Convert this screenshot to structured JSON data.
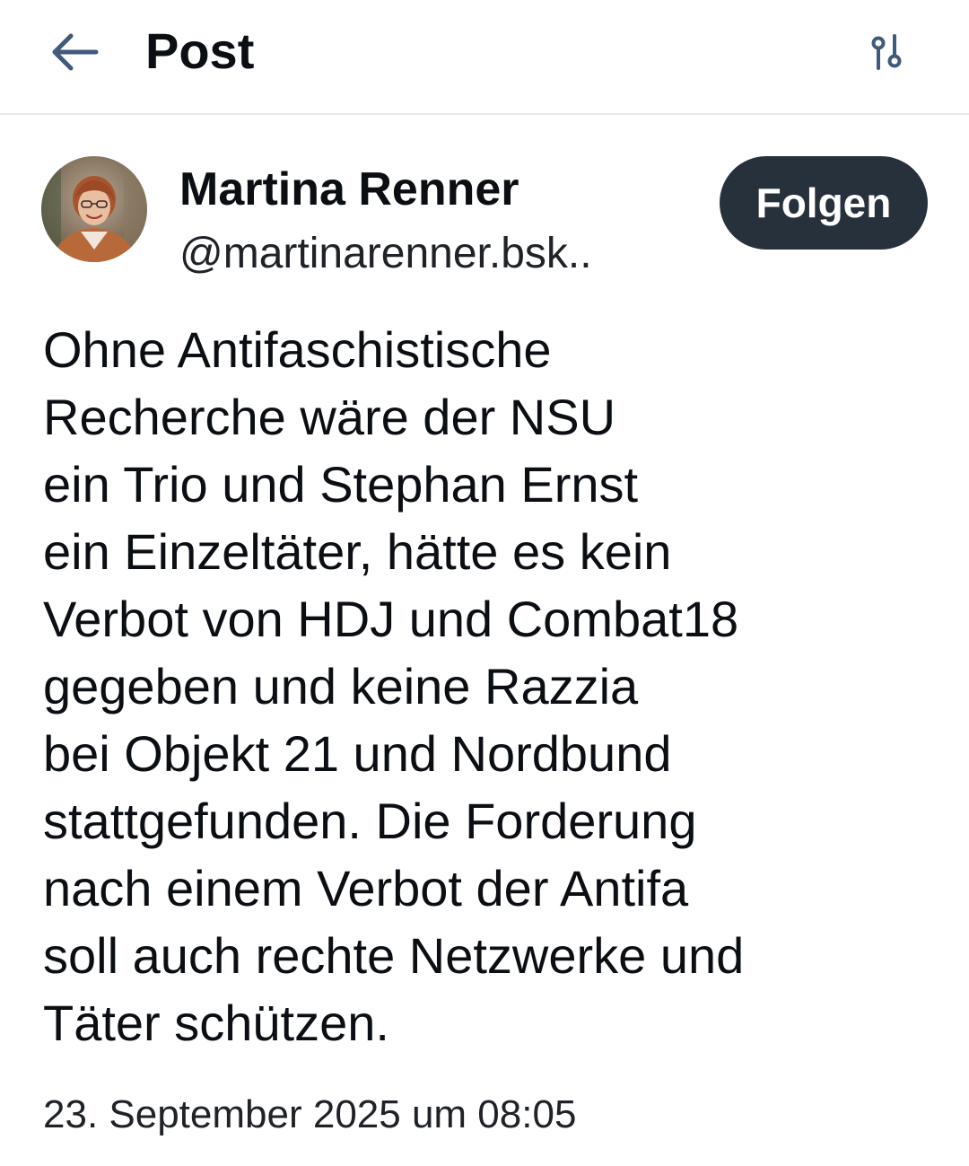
{
  "header": {
    "title": "Post",
    "back_icon": "arrow-left-icon",
    "settings_icon": "sliders-icon",
    "icon_color": "#3f5a7c"
  },
  "author": {
    "name": "Martina Renner",
    "handle": "@martinarenner.bsk..",
    "follow_label": "Folgen",
    "follow_bg": "#27313c"
  },
  "post": {
    "text": "Ohne Antifaschistische\nRecherche wäre der NSU\nein Trio und Stephan Ernst\nein Einzeltäter, hätte es kein\nVerbot von HDJ und Combat18\ngegeben und keine Razzia\nbei Objekt 21 und Nordbund\nstattgefunden. Die Forderung\nnach einem Verbot der Antifa\nsoll auch rechte Netzwerke und\nTäter schützen.",
    "timestamp": "23. September 2025 um 08:05"
  }
}
